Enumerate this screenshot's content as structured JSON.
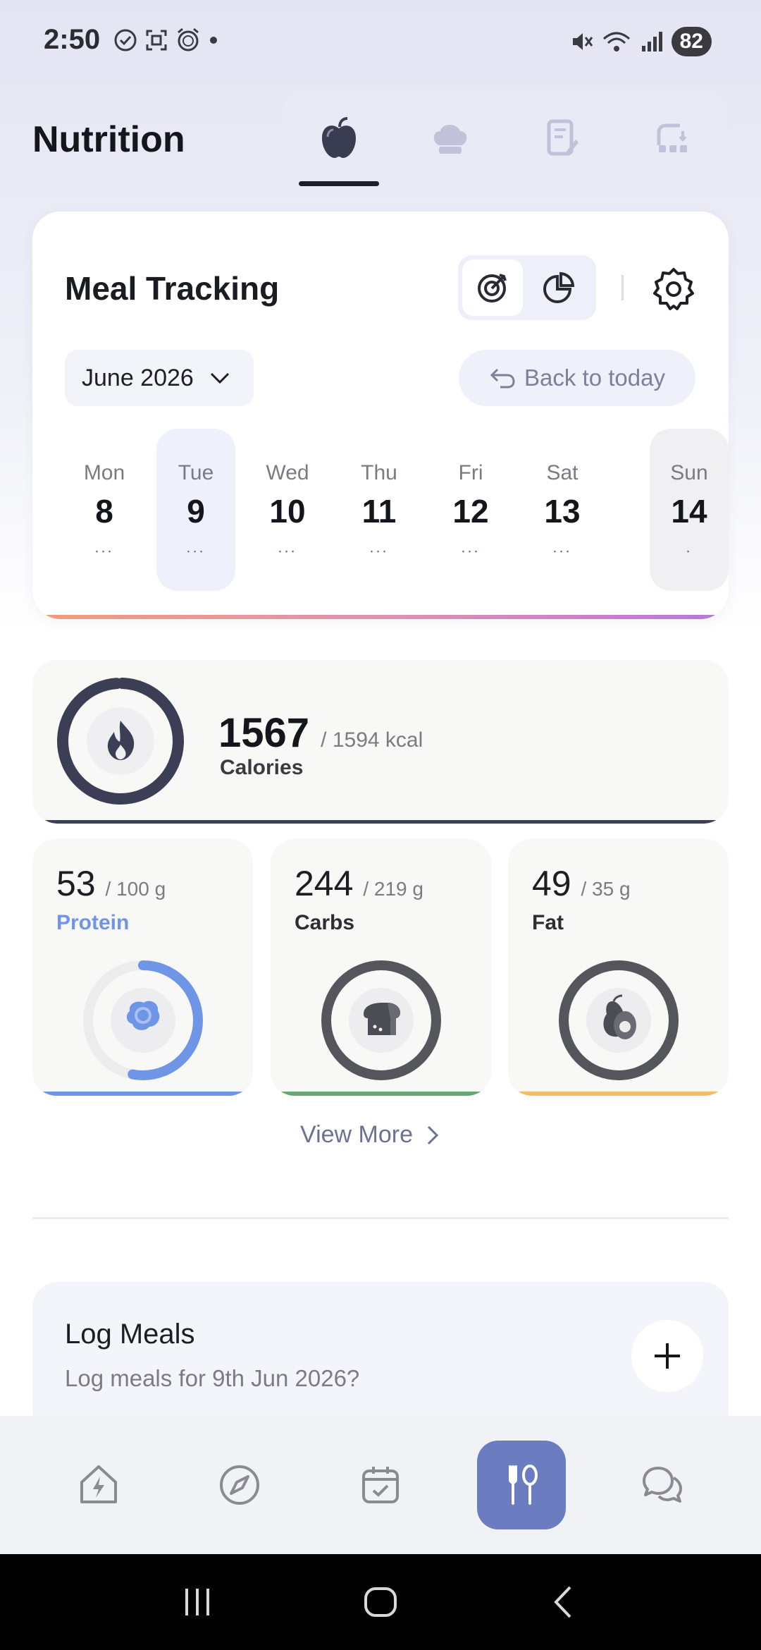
{
  "status_bar": {
    "time": "2:50",
    "battery": "82"
  },
  "header": {
    "title": "Nutrition",
    "tabs": [
      {
        "icon": "apple-icon",
        "active": true
      },
      {
        "icon": "chef-hat-icon",
        "active": false
      },
      {
        "icon": "recipe-book-icon",
        "active": false
      },
      {
        "icon": "meal-plan-icon",
        "active": false
      }
    ]
  },
  "tracking": {
    "title": "Meal Tracking",
    "month": "June 2026",
    "back_to_today": "Back to today",
    "days": [
      {
        "name": "Mon",
        "num": "8",
        "dots": "•••\n•••"
      },
      {
        "name": "Tue",
        "num": "9",
        "dots": "•••"
      },
      {
        "name": "Wed",
        "num": "10",
        "dots": "•••"
      },
      {
        "name": "Thu",
        "num": "11",
        "dots": "•••"
      },
      {
        "name": "Fri",
        "num": "12",
        "dots": "•••"
      },
      {
        "name": "Sat",
        "num": "13",
        "dots": "•••"
      },
      {
        "name": "Sun",
        "num": "14",
        "dots": "•"
      }
    ]
  },
  "calories": {
    "value": "1567",
    "goal": "/ 1594 kcal",
    "label": "Calories",
    "progress": 0.983
  },
  "macros": [
    {
      "value": "53",
      "goal": "/ 100 g",
      "label": "Protein",
      "progress": 0.53,
      "color": "#6f96e6"
    },
    {
      "value": "244",
      "goal": "/ 219 g",
      "label": "Carbs",
      "progress": 1.0,
      "color": "#55555c"
    },
    {
      "value": "49",
      "goal": "/ 35 g",
      "label": "Fat",
      "progress": 1.0,
      "color": "#55555c"
    }
  ],
  "view_more": "View More",
  "log_meals": {
    "title": "Log Meals",
    "subtitle": "Log meals for 9th Jun 2026?"
  },
  "bottom_nav": [
    {
      "icon": "home-bolt-icon",
      "active": false
    },
    {
      "icon": "compass-icon",
      "active": false
    },
    {
      "icon": "calendar-check-icon",
      "active": false
    },
    {
      "icon": "fork-spoon-icon",
      "active": true
    },
    {
      "icon": "chat-icon",
      "active": false
    }
  ],
  "colors": {
    "accent": "#6b7cc0",
    "protein": "#6f96e6",
    "carbs": "#6aa773",
    "fat": "#f1bf63",
    "calorie_ring": "#3b3e54"
  }
}
